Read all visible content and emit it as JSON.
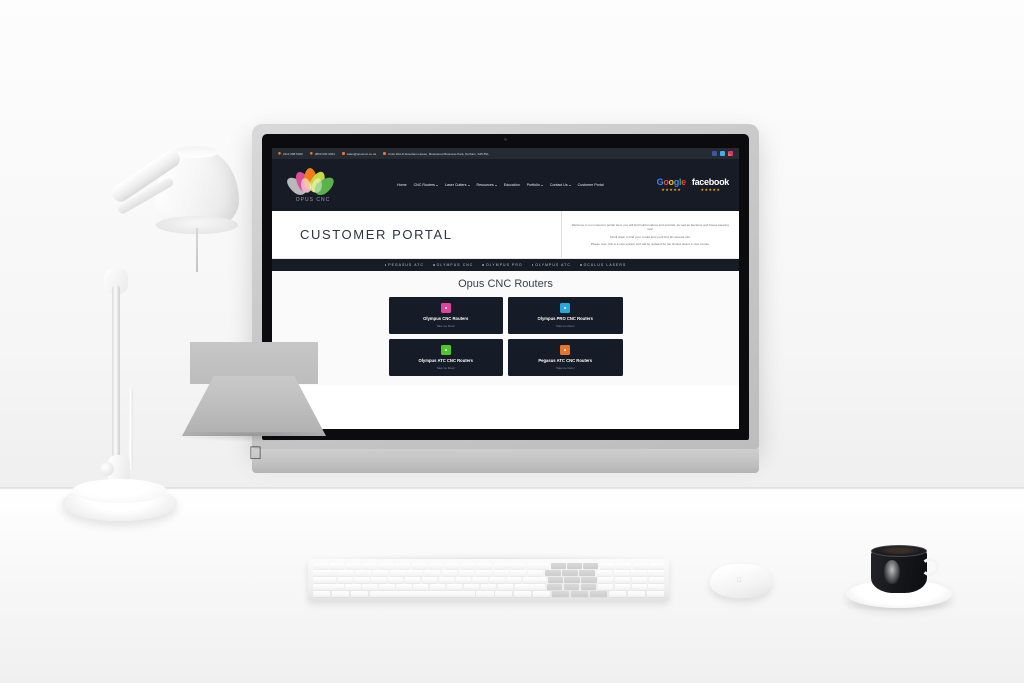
{
  "scene": {
    "objects": {
      "lamp": "desk-lamp",
      "monitor": "imac-all-in-one-computer",
      "keyboard": "apple-magic-keyboard",
      "mouse": "apple-magic-mouse",
      "coffee": "espresso-cup-and-saucer"
    }
  },
  "site": {
    "topbar": {
      "items": [
        {
          "icon": "phone-icon",
          "text": "0113 288 5300"
        },
        {
          "icon": "phone-icon",
          "text": "0800 030 3454"
        },
        {
          "icon": "envelope-icon",
          "text": "sales@opuscnc.co.uk"
        },
        {
          "icon": "location-pin-icon",
          "text": "Units 20A-D Evesham House, Meanwood Business Park, Durham, S45 8SL"
        }
      ],
      "social": [
        {
          "name": "facebook-icon",
          "color": "#3b5998"
        },
        {
          "name": "twitter-icon",
          "color": "#4aa7e8"
        },
        {
          "name": "instagram-icon",
          "color": "#e1306c"
        }
      ]
    },
    "header": {
      "logo_text": "OPUS CNC",
      "nav": [
        {
          "label": "Home",
          "has_dropdown": false
        },
        {
          "label": "CNC Routers",
          "has_dropdown": true
        },
        {
          "label": "Laser Cutters",
          "has_dropdown": true
        },
        {
          "label": "Resources",
          "has_dropdown": true
        },
        {
          "label": "Education",
          "has_dropdown": false
        },
        {
          "label": "Portfolio",
          "has_dropdown": true
        },
        {
          "label": "Contact Us",
          "has_dropdown": true
        },
        {
          "label": "Customer Portal",
          "has_dropdown": false
        }
      ],
      "badges": [
        {
          "name": "google-reviews-badge",
          "word": "Google",
          "stars": "★★★★★"
        },
        {
          "name": "facebook-reviews-badge",
          "word": "facebook",
          "stars": "★★★★★"
        }
      ]
    },
    "hero": {
      "title": "CUSTOMER PORTAL",
      "paragraphs": [
        "Welcome to our customer portal! Here you will find helpful videos and tutorials, as well as literature and house-keeping tips!",
        "Scroll down to find your model and you'll find all relevant info.",
        "Please note, this is a new system and will be updated for the Oculus lasers in due course."
      ]
    },
    "strip": {
      "items": [
        "PEGASUS ATC",
        "OLYMPUS CNC",
        "OLYMPUS PRO",
        "OLYMPUS ATC",
        "OCULUS LASERS"
      ]
    },
    "main": {
      "title": "Opus CNC Routers",
      "cards": [
        {
          "title": "Olympus CNC Routers",
          "subtitle": "Take me there!",
          "icon": "router-tile-icon",
          "color": "#e0439b"
        },
        {
          "title": "Olympus PRO CNC Routers",
          "subtitle": "Take me there!",
          "icon": "router-tile-icon",
          "color": "#29a8df"
        },
        {
          "title": "Olympus ATC CNC Routers",
          "subtitle": "Take me there!",
          "icon": "router-tile-icon",
          "color": "#4fc72b"
        },
        {
          "title": "Pegasus ATC CNC Routers",
          "subtitle": "Take me there!",
          "icon": "router-tile-icon",
          "color": "#e8742a"
        }
      ]
    }
  }
}
